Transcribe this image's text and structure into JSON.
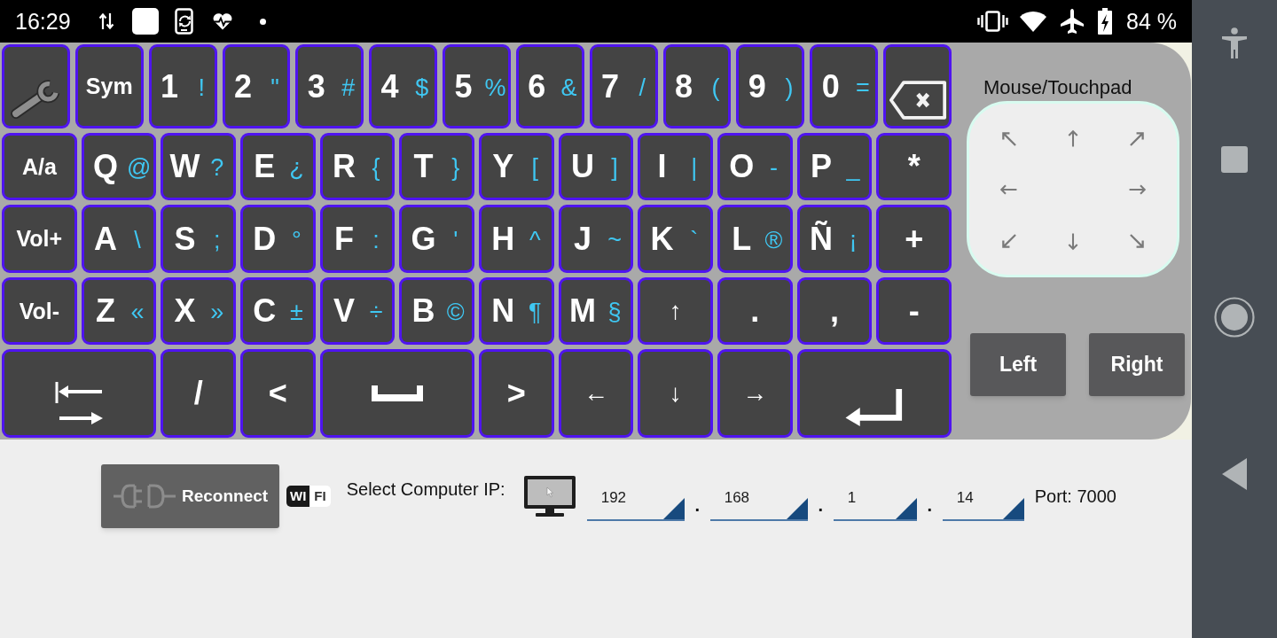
{
  "status_bar": {
    "time": "16:29",
    "battery": "84 %"
  },
  "keyboard": {
    "number_row": [
      {
        "kind": "settings"
      },
      {
        "kind": "word",
        "label": "Sym"
      },
      {
        "kind": "char",
        "label": "1",
        "alt": "!"
      },
      {
        "kind": "char",
        "label": "2",
        "alt": "\""
      },
      {
        "kind": "char",
        "label": "3",
        "alt": "#"
      },
      {
        "kind": "char",
        "label": "4",
        "alt": "$"
      },
      {
        "kind": "char",
        "label": "5",
        "alt": "%"
      },
      {
        "kind": "char",
        "label": "6",
        "alt": "&"
      },
      {
        "kind": "char",
        "label": "7",
        "alt": "/"
      },
      {
        "kind": "char",
        "label": "8",
        "alt": "("
      },
      {
        "kind": "char",
        "label": "9",
        "alt": ")"
      },
      {
        "kind": "char",
        "label": "0",
        "alt": "="
      },
      {
        "kind": "backspace"
      }
    ],
    "rows": [
      [
        {
          "kind": "word",
          "label": "A/a"
        },
        {
          "kind": "char",
          "label": "Q",
          "alt": "@"
        },
        {
          "kind": "char",
          "label": "W",
          "alt": "?"
        },
        {
          "kind": "char",
          "label": "E",
          "alt": "¿"
        },
        {
          "kind": "char",
          "label": "R",
          "alt": "{"
        },
        {
          "kind": "char",
          "label": "T",
          "alt": "}"
        },
        {
          "kind": "char",
          "label": "Y",
          "alt": "["
        },
        {
          "kind": "char",
          "label": "U",
          "alt": "]"
        },
        {
          "kind": "char",
          "label": "I",
          "alt": "|"
        },
        {
          "kind": "char",
          "label": "O",
          "alt": "-"
        },
        {
          "kind": "char",
          "label": "P",
          "alt": "_"
        },
        {
          "kind": "char",
          "label": "*"
        }
      ],
      [
        {
          "kind": "word",
          "label": "Vol+"
        },
        {
          "kind": "char",
          "label": "A",
          "alt": "\\"
        },
        {
          "kind": "char",
          "label": "S",
          "alt": ";"
        },
        {
          "kind": "char",
          "label": "D",
          "alt": "°"
        },
        {
          "kind": "char",
          "label": "F",
          "alt": ":"
        },
        {
          "kind": "char",
          "label": "G",
          "alt": "'"
        },
        {
          "kind": "char",
          "label": "H",
          "alt": "^"
        },
        {
          "kind": "char",
          "label": "J",
          "alt": "~"
        },
        {
          "kind": "char",
          "label": "K",
          "alt": "`"
        },
        {
          "kind": "char",
          "label": "L",
          "alt": "®"
        },
        {
          "kind": "char",
          "label": "Ñ",
          "alt": "¡"
        },
        {
          "kind": "char",
          "label": "+"
        }
      ],
      [
        {
          "kind": "word",
          "label": "Vol-"
        },
        {
          "kind": "char",
          "label": "Z",
          "alt": "«"
        },
        {
          "kind": "char",
          "label": "X",
          "alt": "»"
        },
        {
          "kind": "char",
          "label": "C",
          "alt": "±"
        },
        {
          "kind": "char",
          "label": "V",
          "alt": "÷"
        },
        {
          "kind": "char",
          "label": "B",
          "alt": "©"
        },
        {
          "kind": "char",
          "label": "N",
          "alt": "¶"
        },
        {
          "kind": "char",
          "label": "M",
          "alt": "§"
        },
        {
          "kind": "arrow",
          "label": "↑"
        },
        {
          "kind": "char",
          "label": "."
        },
        {
          "kind": "char",
          "label": ","
        },
        {
          "kind": "char",
          "label": "-"
        }
      ],
      [
        {
          "kind": "tab",
          "colspan": 2
        },
        {
          "kind": "char",
          "label": "/"
        },
        {
          "kind": "char",
          "label": "<"
        },
        {
          "kind": "space",
          "colspan": 2
        },
        {
          "kind": "char",
          "label": ">"
        },
        {
          "kind": "arrow",
          "label": "←"
        },
        {
          "kind": "arrow",
          "label": "↓"
        },
        {
          "kind": "arrow",
          "label": "→"
        },
        {
          "kind": "enter",
          "colspan": 2
        }
      ]
    ]
  },
  "mouse_panel": {
    "title": "Mouse/Touchpad",
    "buttons": [
      "Left",
      "Right"
    ]
  },
  "connection": {
    "reconnect_button": "Reconnect",
    "wifi_logo": [
      "WI",
      "FI"
    ],
    "ip_label": "Select Computer IP:",
    "ip_fields": [
      {
        "value": "192"
      },
      {
        "value": "168"
      },
      {
        "value": "1"
      },
      {
        "value": "14"
      }
    ],
    "separators": [
      ".",
      ".",
      "."
    ],
    "port": "Port: 7000"
  }
}
